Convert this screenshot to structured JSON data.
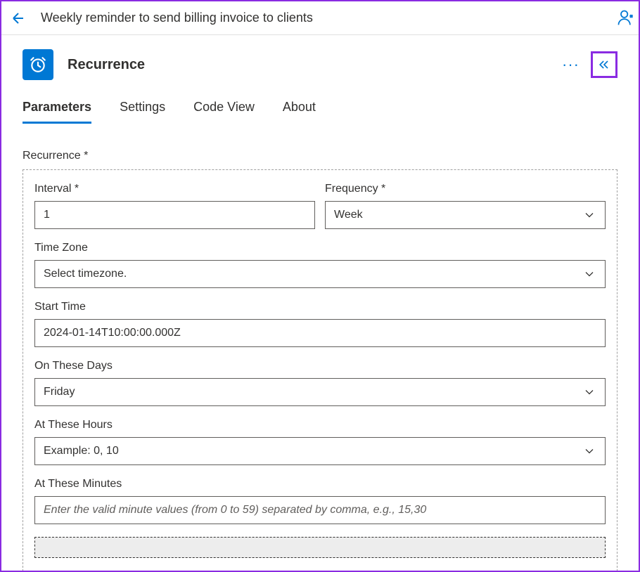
{
  "header": {
    "title": "Weekly reminder to send billing invoice to clients"
  },
  "action": {
    "title": "Recurrence"
  },
  "tabs": {
    "parameters": "Parameters",
    "settings": "Settings",
    "codeview": "Code View",
    "about": "About"
  },
  "section": {
    "label": "Recurrence *"
  },
  "fields": {
    "interval": {
      "label": "Interval *",
      "value": "1"
    },
    "frequency": {
      "label": "Frequency *",
      "value": "Week"
    },
    "timezone": {
      "label": "Time Zone",
      "placeholder": "Select timezone."
    },
    "starttime": {
      "label": "Start Time",
      "value": "2024-01-14T10:00:00.000Z"
    },
    "ondays": {
      "label": "On These Days",
      "value": "Friday"
    },
    "athours": {
      "label": "At These Hours",
      "placeholder": "Example: 0, 10"
    },
    "atminutes": {
      "label": "At These Minutes",
      "placeholder": "Enter the valid minute values (from 0 to 59) separated by comma, e.g., 15,30"
    }
  }
}
